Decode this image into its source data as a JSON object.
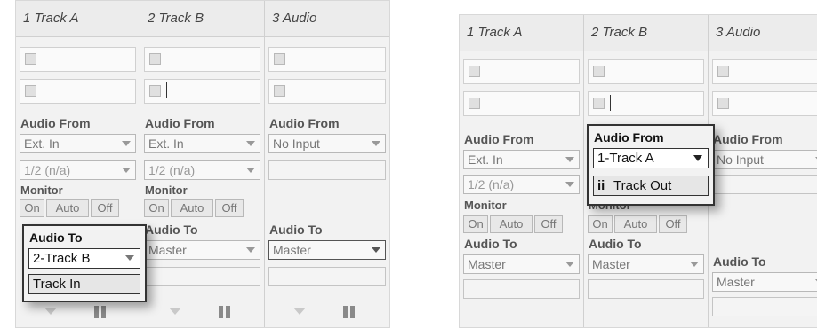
{
  "panel_left": {
    "tracks": [
      {
        "name": "1 Track A",
        "audio_from_label": "Audio From",
        "input_type": "Ext. In",
        "input_channel": "1/2 (n/a)",
        "monitor_label": "Monitor",
        "monitor_options": [
          "On",
          "Auto",
          "Off"
        ],
        "audio_to_label": "Audio To",
        "output_type": "2-Track B",
        "output_channel": "Track In"
      },
      {
        "name": "2 Track B",
        "audio_from_label": "Audio From",
        "input_type": "Ext. In",
        "input_channel": "1/2 (n/a)",
        "monitor_label": "Monitor",
        "monitor_options": [
          "On",
          "Auto",
          "Off"
        ],
        "audio_to_label": "Audio To",
        "output_type": "Master"
      },
      {
        "name": "3 Audio",
        "audio_from_label": "Audio From",
        "input_type": "No Input",
        "audio_to_label": "Audio To",
        "output_type": "Master"
      }
    ]
  },
  "panel_right": {
    "tracks": [
      {
        "name": "1 Track A",
        "audio_from_label": "Audio From",
        "input_type": "Ext. In",
        "input_channel": "1/2 (n/a)",
        "monitor_label": "Monitor",
        "monitor_options": [
          "On",
          "Auto",
          "Off"
        ],
        "audio_to_label": "Audio To",
        "output_type": "Master"
      },
      {
        "name": "2 Track B",
        "audio_from_label": "Audio From",
        "input_type": "1-Track A",
        "input_channel": "Track Out",
        "monitor_label": "Monitor",
        "monitor_options": [
          "On",
          "Auto",
          "Off"
        ],
        "audio_to_label": "Audio To",
        "output_type": "Master"
      },
      {
        "name": "3 Audio",
        "audio_from_label": "Audio From",
        "input_type": "No Input",
        "audio_to_label": "Audio To",
        "output_type": "Master"
      }
    ]
  },
  "icons": {
    "track_out_prefix": "ii"
  }
}
